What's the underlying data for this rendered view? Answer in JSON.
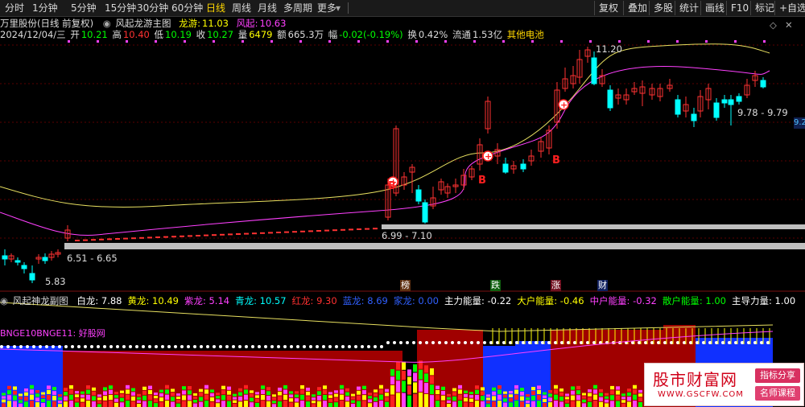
{
  "toolbar": {
    "periods": [
      "分时",
      "1分钟",
      "5分钟",
      "15分钟",
      "30分钟",
      "60分钟",
      "日线",
      "周线",
      "月线",
      "多周期",
      "更多"
    ],
    "active": "日线",
    "right_buttons": [
      "复权",
      "叠加",
      "多股",
      "统计",
      "画线",
      "F10",
      "标记",
      "+自选"
    ]
  },
  "stock": {
    "title": "万里股份(日线 前复权)",
    "indicator_name": "风起龙游主图",
    "longyou_label": "龙游:",
    "longyou_value": "11.03",
    "fengqi_label": "风起:",
    "fengqi_value": "10.63",
    "date": "2024/12/04/三",
    "open_label": "开",
    "open": "10.21",
    "high_label": "高",
    "high": "10.40",
    "low_label": "低",
    "low": "10.19",
    "close_label": "收",
    "close": "10.27",
    "vol_label": "量",
    "vol": "6479",
    "amount_label": "额",
    "amount": "665.3万",
    "change_label": "幅",
    "change": "-0.02(-0.19%)",
    "turnover_label": "换",
    "turnover": "0.42%",
    "float_label": "流通",
    "float": "1.53亿",
    "concept": "其他电池"
  },
  "annotations": {
    "high_price": "11.20",
    "low_price": "5.83",
    "range1": "6.51 - 6.65",
    "range2": "6.99 - 7.10",
    "range3": "9.78 - 9.79",
    "right_price": "9.2",
    "signal_b": "B",
    "marks": [
      "榜",
      "跌",
      "涨",
      "财"
    ]
  },
  "sub": {
    "name": "风起神龙副图",
    "items": [
      {
        "label": "白龙:",
        "value": "7.88",
        "color": "#ffffff"
      },
      {
        "label": "黄龙:",
        "value": "10.49",
        "color": "#ffff00"
      },
      {
        "label": "紫龙:",
        "value": "5.14",
        "color": "#ff40ff"
      },
      {
        "label": "青龙:",
        "value": "10.57",
        "color": "#00ffff"
      },
      {
        "label": "红龙:",
        "value": "9.30",
        "color": "#ff3030"
      },
      {
        "label": "蓝龙:",
        "value": "8.69",
        "color": "#3060ff"
      },
      {
        "label": "家龙:",
        "value": "0.00",
        "color": "#3060ff"
      },
      {
        "label": "主力能量:",
        "value": "-0.22",
        "color": "#ffffff"
      },
      {
        "label": "大户能量:",
        "value": "-0.46",
        "color": "#ffff00"
      },
      {
        "label": "中户能量:",
        "value": "-0.32",
        "color": "#ff40ff"
      },
      {
        "label": "散户能量:",
        "value": "1.00",
        "color": "#00ff00"
      },
      {
        "label": "主导力量:",
        "value": "1.00",
        "color": "#ffffff"
      }
    ],
    "bnge": "BNGE10BNGE11: 好股网"
  },
  "watermark": {
    "title": "股市财富网",
    "url": "WWW.GSCFW.COM",
    "tag1": "指标分享",
    "tag2": "名师课程"
  },
  "colors": {
    "up": "#ff3232",
    "down": "#00ffff",
    "toolbar_bg": "#1a1a1a"
  }
}
